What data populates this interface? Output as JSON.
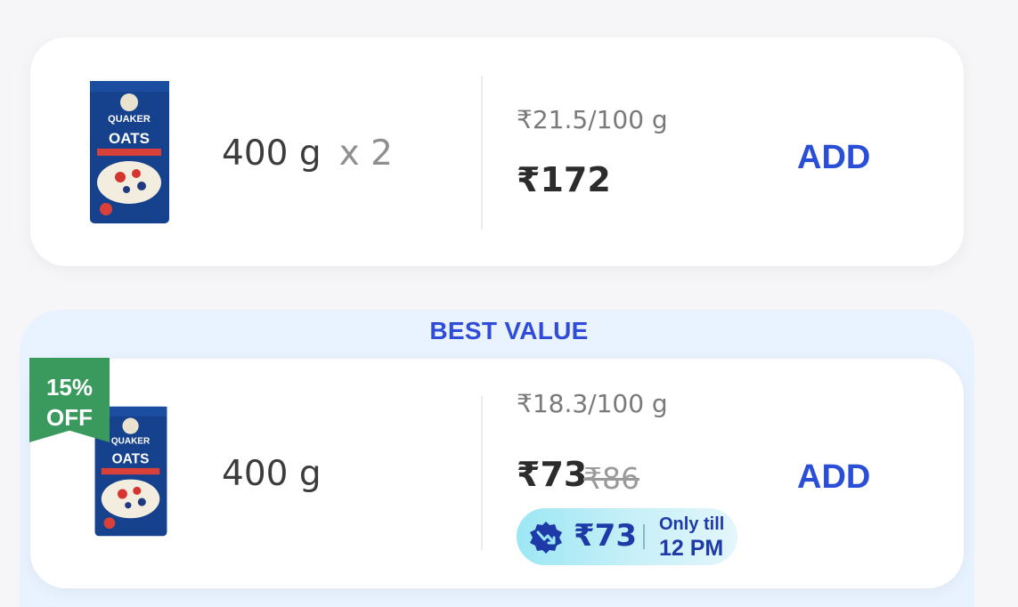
{
  "options": [
    {
      "size": "400 g",
      "multiplier": "x 2",
      "unit_price": "₹21.5/100 g",
      "price": "₹172",
      "add_label": "ADD",
      "product_image": "quaker-oats-pack"
    },
    {
      "section_label": "BEST VALUE",
      "discount_badge": {
        "line1": "15%",
        "line2": "OFF",
        "color": "#3a9a5e"
      },
      "size": "400 g",
      "unit_price": "₹18.3/100 g",
      "price": "₹73",
      "mrp": "₹86",
      "add_label": "ADD",
      "product_image": "quaker-oats-pack",
      "deal": {
        "icon": "price-drop-badge-icon",
        "price": "₹73",
        "line1": "Only till",
        "line2": "12 PM"
      }
    }
  ],
  "colors": {
    "accent": "#2a4fd6",
    "best_value_bg": "#e9f2ff",
    "deal_gradient_start": "#9ce7f4"
  }
}
